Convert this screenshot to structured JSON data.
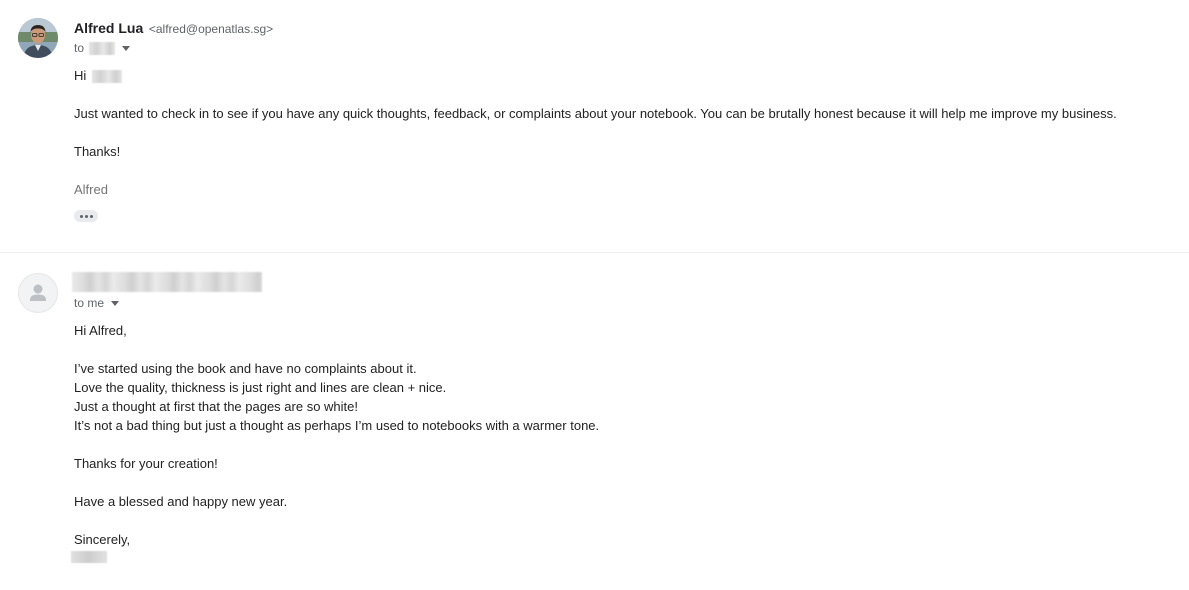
{
  "messages": [
    {
      "sender_name": "Alfred Lua",
      "sender_email": "<alfred@openatlas.sg>",
      "recipient_prefix": "to",
      "greeting": "Hi",
      "paragraphs": [
        "Just wanted to check in to see if you have any quick thoughts, feedback, or complaints about your notebook. You can be brutally honest because it will help me improve my business.",
        "Thanks!"
      ],
      "signature": "Alfred"
    },
    {
      "recipient_label": "to me",
      "greeting": "Hi Alfred,",
      "lines": [
        "I’ve started using the book and have no complaints about it.",
        "Love the quality, thickness is just right and lines are clean + nice.",
        "Just a thought at first that the pages are so white!",
        "It’s not a bad thing but just a thought as perhaps I’m used to notebooks with a warmer tone."
      ],
      "thanks": "Thanks for your creation!",
      "wishes": "Have a blessed and happy new year.",
      "closing": "Sincerely,"
    }
  ],
  "icons": {
    "caret": "chevron-down-icon",
    "more": "more-horiz-icon",
    "default_avatar": "person-icon"
  },
  "colors": {
    "sender_name": "#202124",
    "meta_text": "#5f6368",
    "body_text": "#222222",
    "signature": "#757575"
  }
}
